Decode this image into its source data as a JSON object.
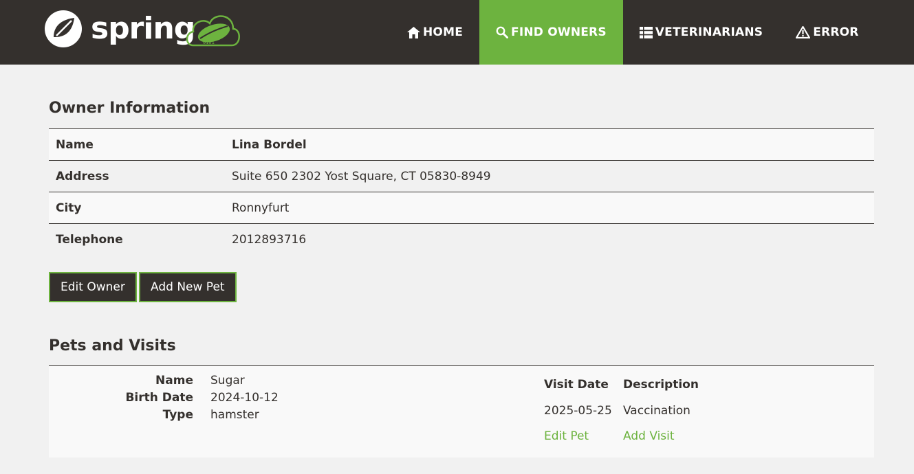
{
  "brand": {
    "logo_text": "spring",
    "accent": "#6db33f",
    "dark": "#34302d"
  },
  "nav": {
    "home": "HOME",
    "find_owners": "FIND OWNERS",
    "veterinarians": "VETERINARIANS",
    "error": "ERROR",
    "active": "find_owners"
  },
  "owner": {
    "heading": "Owner Information",
    "rows": [
      {
        "label": "Name",
        "value": "Lina Bordel"
      },
      {
        "label": "Address",
        "value": "Suite 650 2302 Yost Square, CT 05830-8949"
      },
      {
        "label": "City",
        "value": "Ronnyfurt"
      },
      {
        "label": "Telephone",
        "value": "2012893716"
      }
    ],
    "edit_button": "Edit Owner",
    "add_pet_button": "Add New Pet"
  },
  "pets": {
    "heading": "Pets and Visits",
    "list": [
      {
        "name_label": "Name",
        "name": "Sugar",
        "birth_label": "Birth Date",
        "birth_date": "2024-10-12",
        "type_label": "Type",
        "type": "hamster",
        "visit_date_header": "Visit Date",
        "description_header": "Description",
        "visits": [
          {
            "date": "2025-05-25",
            "description": "Vaccination"
          }
        ],
        "edit_pet_link": "Edit Pet",
        "add_visit_link": "Add Visit"
      }
    ]
  }
}
